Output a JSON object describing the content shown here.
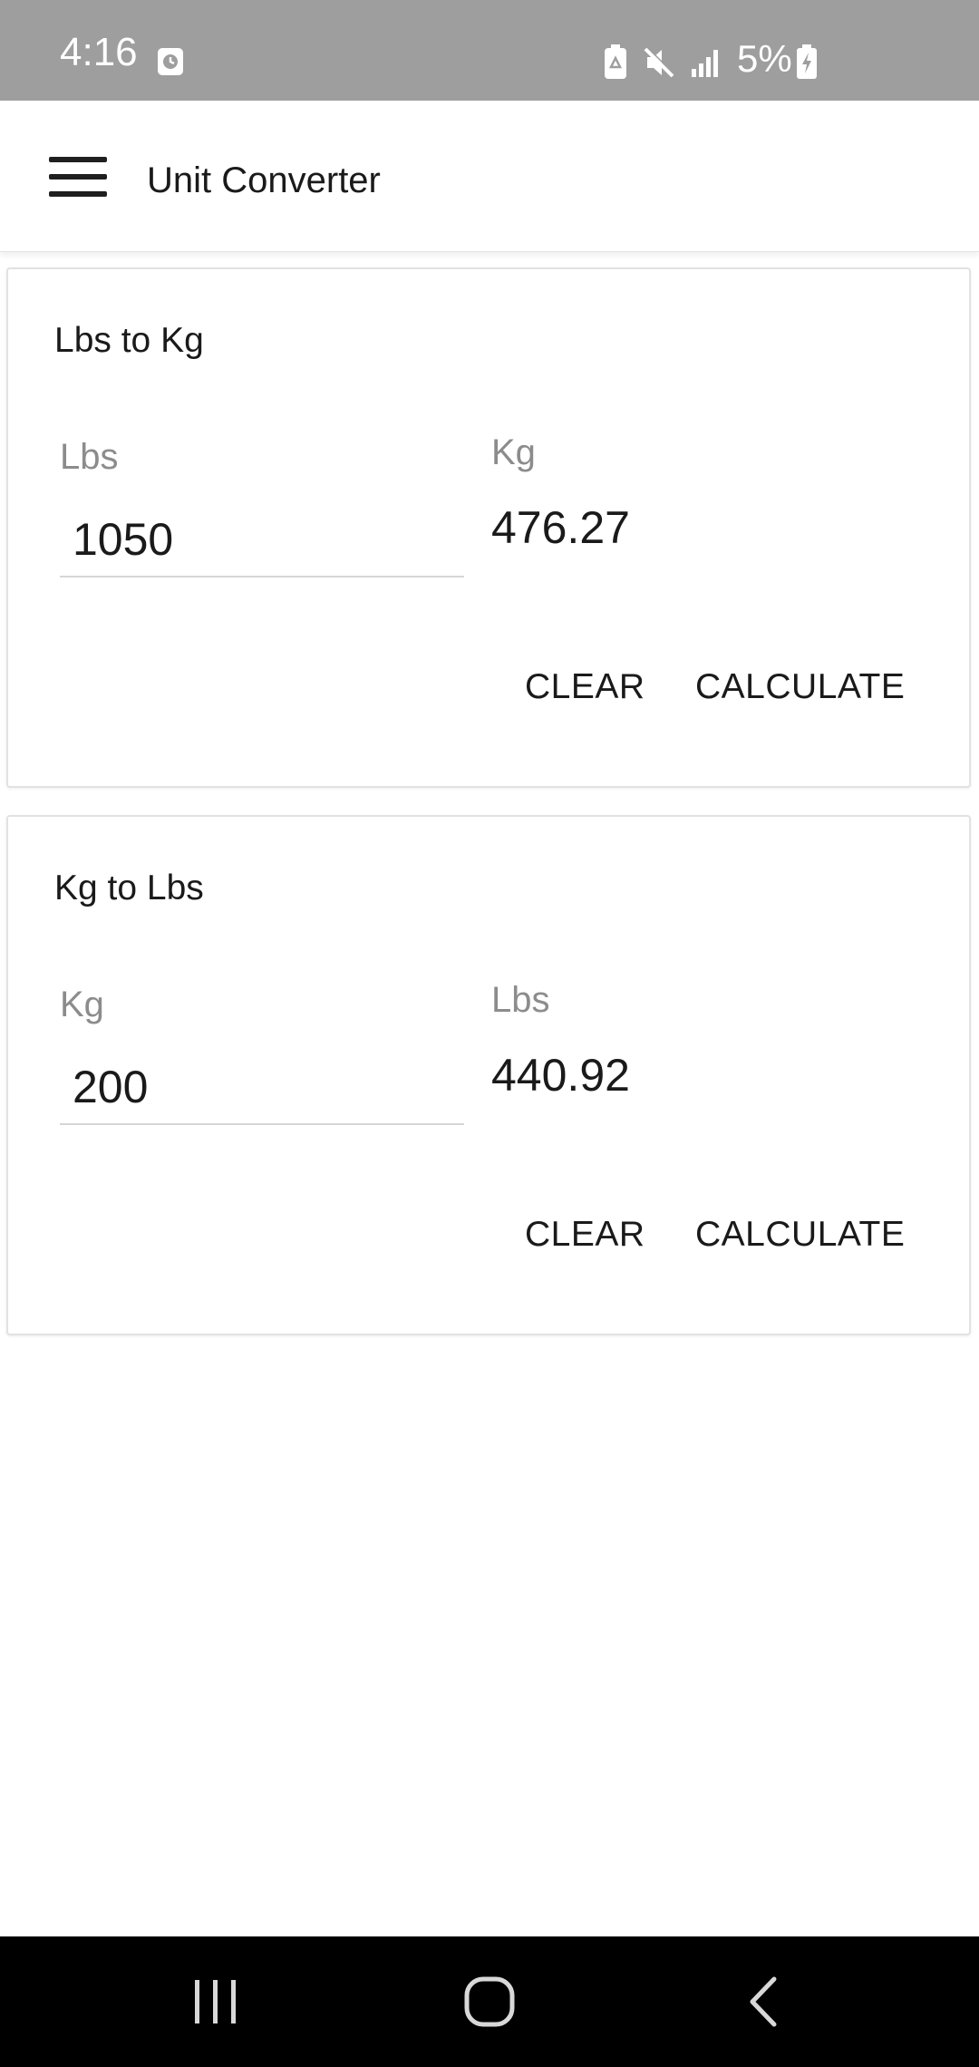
{
  "status_bar": {
    "time": "4:16",
    "battery_percent": "5%",
    "icons": [
      "screenshot-icon",
      "battery-saver-icon",
      "mute-icon",
      "signal-icon",
      "battery-charging-icon"
    ]
  },
  "app_bar": {
    "title": "Unit Converter",
    "menu_icon": "hamburger-menu-icon"
  },
  "converters": [
    {
      "title": "Lbs to Kg",
      "input_label": "Lbs",
      "input_value": "1050",
      "output_label": "Kg",
      "output_value": "476.27",
      "clear_label": "CLEAR",
      "calculate_label": "CALCULATE"
    },
    {
      "title": "Kg to Lbs",
      "input_label": "Kg",
      "input_value": "200",
      "output_label": "Lbs",
      "output_value": "440.92",
      "clear_label": "CLEAR",
      "calculate_label": "CALCULATE"
    }
  ],
  "nav_bar": {
    "buttons": [
      "recents-icon",
      "home-icon",
      "back-icon"
    ]
  },
  "colors": {
    "status_bar_bg": "#9e9e9e",
    "label_gray": "#8c8c8c",
    "nav_bar_bg": "#000000"
  }
}
